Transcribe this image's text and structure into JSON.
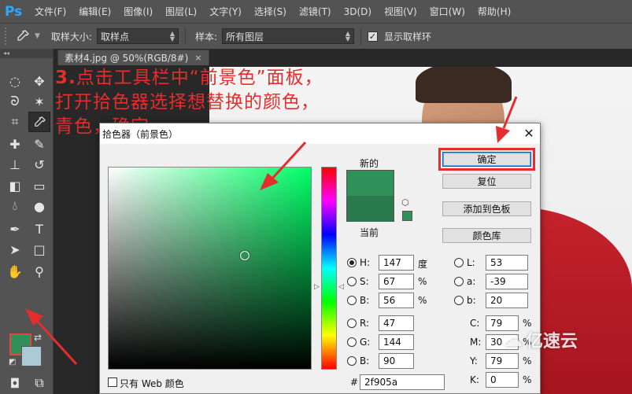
{
  "app": {
    "logo": "Ps",
    "accent": "#31a8ff"
  },
  "menu": [
    "文件(F)",
    "编辑(E)",
    "图像(I)",
    "图层(L)",
    "文字(Y)",
    "选择(S)",
    "滤镜(T)",
    "3D(D)",
    "视图(V)",
    "窗口(W)",
    "帮助(H)"
  ],
  "options": {
    "tool_icon": "eyedropper-icon",
    "sample_size_label": "取样大小:",
    "sample_size_value": "取样点",
    "sample_label": "样本:",
    "sample_value": "所有图层",
    "show_ring_label": "显示取样环",
    "show_ring_checked": true
  },
  "toolbar": {
    "collapse": "◂◂",
    "foreground_color": "#2f905a",
    "background_color": "#aec9d6"
  },
  "document": {
    "tab_title": "素材4.jpg @ 50%(RGB/8#)",
    "close": "×"
  },
  "annotation": {
    "number": "3.",
    "line1": "点击工具栏中“前景色”面板，",
    "line2": "打开拾色器选择想替换的颜色，",
    "line3": "青色，确定。",
    "color": "#e52d2d"
  },
  "dialog": {
    "title": "拾色器（前景色）",
    "close": "✕",
    "new_label": "新的",
    "current_label": "当前",
    "new_color": "#2f905a",
    "current_color": "#2a7a4e",
    "buttons": {
      "ok": "确定",
      "reset": "复位",
      "add_swatch": "添加到色板",
      "libraries": "颜色库"
    },
    "hsb": [
      {
        "key": "H:",
        "value": "147",
        "unit": "度",
        "selected": true
      },
      {
        "key": "S:",
        "value": "67",
        "unit": "%",
        "selected": false
      },
      {
        "key": "B:",
        "value": "56",
        "unit": "%",
        "selected": false
      }
    ],
    "rgb": [
      {
        "key": "R:",
        "value": "47"
      },
      {
        "key": "G:",
        "value": "144"
      },
      {
        "key": "B:",
        "value": "90"
      }
    ],
    "lab": [
      {
        "key": "L:",
        "value": "53"
      },
      {
        "key": "a:",
        "value": "-39"
      },
      {
        "key": "b:",
        "value": "20"
      }
    ],
    "cmyk": [
      {
        "key": "C:",
        "value": "79",
        "unit": "%"
      },
      {
        "key": "M:",
        "value": "30",
        "unit": "%"
      },
      {
        "key": "Y:",
        "value": "79",
        "unit": "%"
      },
      {
        "key": "K:",
        "value": "0",
        "unit": "%"
      }
    ],
    "web_only_label": "只有 Web 颜色",
    "hex_hash": "#",
    "hex_value": "2f905a"
  },
  "watermark": {
    "text": "亿速云",
    "logo": "☁"
  }
}
